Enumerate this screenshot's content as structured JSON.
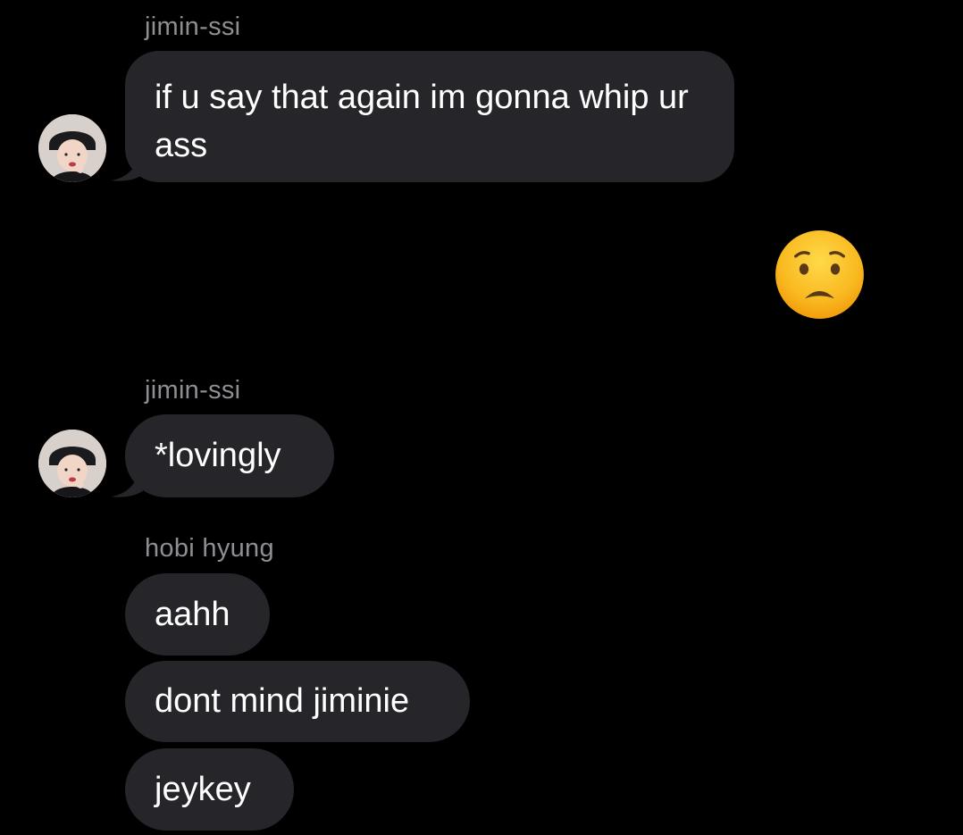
{
  "conversation": {
    "messages": [
      {
        "sender": "jimin-ssi",
        "text": "if u say that again im gonna whip ur ass"
      },
      {
        "reaction_icon": "worried-face-emoji"
      },
      {
        "sender": "jimin-ssi",
        "text": "*lovingly"
      },
      {
        "sender": "hobi hyung",
        "texts": [
          "aahh",
          "dont mind jiminie",
          "jeykey"
        ]
      }
    ]
  },
  "colors": {
    "background": "#000000",
    "bubble": "#262529",
    "sender_label": "#8e8e93",
    "text": "#ffffff"
  }
}
